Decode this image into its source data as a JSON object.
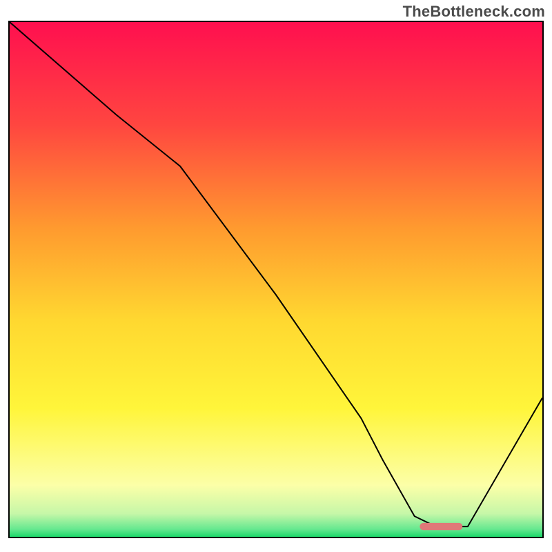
{
  "watermark": "TheBottleneck.com",
  "chart_data": {
    "type": "line",
    "title": "",
    "xlabel": "",
    "ylabel": "",
    "xlim": [
      0,
      100
    ],
    "ylim": [
      0,
      100
    ],
    "grid": false,
    "series": [
      {
        "name": "bottleneck-curve",
        "x": [
          0,
          20,
          32,
          50,
          66,
          70,
          76,
          80,
          86,
          100
        ],
        "values": [
          100,
          82,
          72,
          47,
          23,
          15,
          4,
          2,
          2,
          27
        ]
      }
    ],
    "marker": {
      "name": "optimal-band",
      "x_start": 77,
      "x_end": 85,
      "y": 2,
      "color": "#e07878"
    },
    "background_gradient": {
      "stops": [
        {
          "offset": 0.0,
          "color": "#ff0f4f"
        },
        {
          "offset": 0.2,
          "color": "#ff4640"
        },
        {
          "offset": 0.4,
          "color": "#ff9a2f"
        },
        {
          "offset": 0.58,
          "color": "#ffd830"
        },
        {
          "offset": 0.75,
          "color": "#fff53a"
        },
        {
          "offset": 0.9,
          "color": "#fcffa8"
        },
        {
          "offset": 0.955,
          "color": "#c6f7a8"
        },
        {
          "offset": 0.985,
          "color": "#66e890"
        },
        {
          "offset": 1.0,
          "color": "#1cd86a"
        }
      ]
    }
  }
}
